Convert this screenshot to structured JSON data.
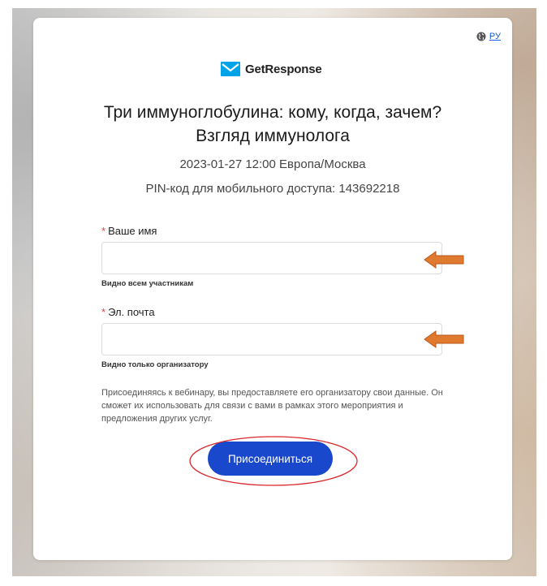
{
  "header": {
    "language_label": "РУ",
    "brand_name": "GetResponse"
  },
  "event": {
    "title": "Три иммуноглобулина: кому, когда, зачем? Взгляд иммунолога",
    "datetime": "2023-01-27 12:00 Европа/Москва",
    "pin_text": "PIN-код для мобильного доступа: 143692218"
  },
  "form": {
    "required_marker": "*",
    "name_label": "Ваше имя",
    "name_value": "",
    "name_hint": "Видно всем участникам",
    "email_label": "Эл. почта",
    "email_value": "",
    "email_hint": "Видно только организатору",
    "consent_text": "Присоединяясь к вебинару, вы предоставляете его организатору свои данные. Он сможет их использовать для связи с вами в рамках этого мероприятия и предложения других услуг.",
    "submit_label": "Присоединиться"
  },
  "colors": {
    "brand_blue": "#1a48cc",
    "logo_blue": "#00a2e8",
    "annotation_arrow": "#e07a2e",
    "annotation_ellipse": "#d9262c",
    "required_marker": "#e0483a"
  },
  "icons": {
    "language": "globe-icon",
    "logo": "envelope-logo-icon"
  }
}
